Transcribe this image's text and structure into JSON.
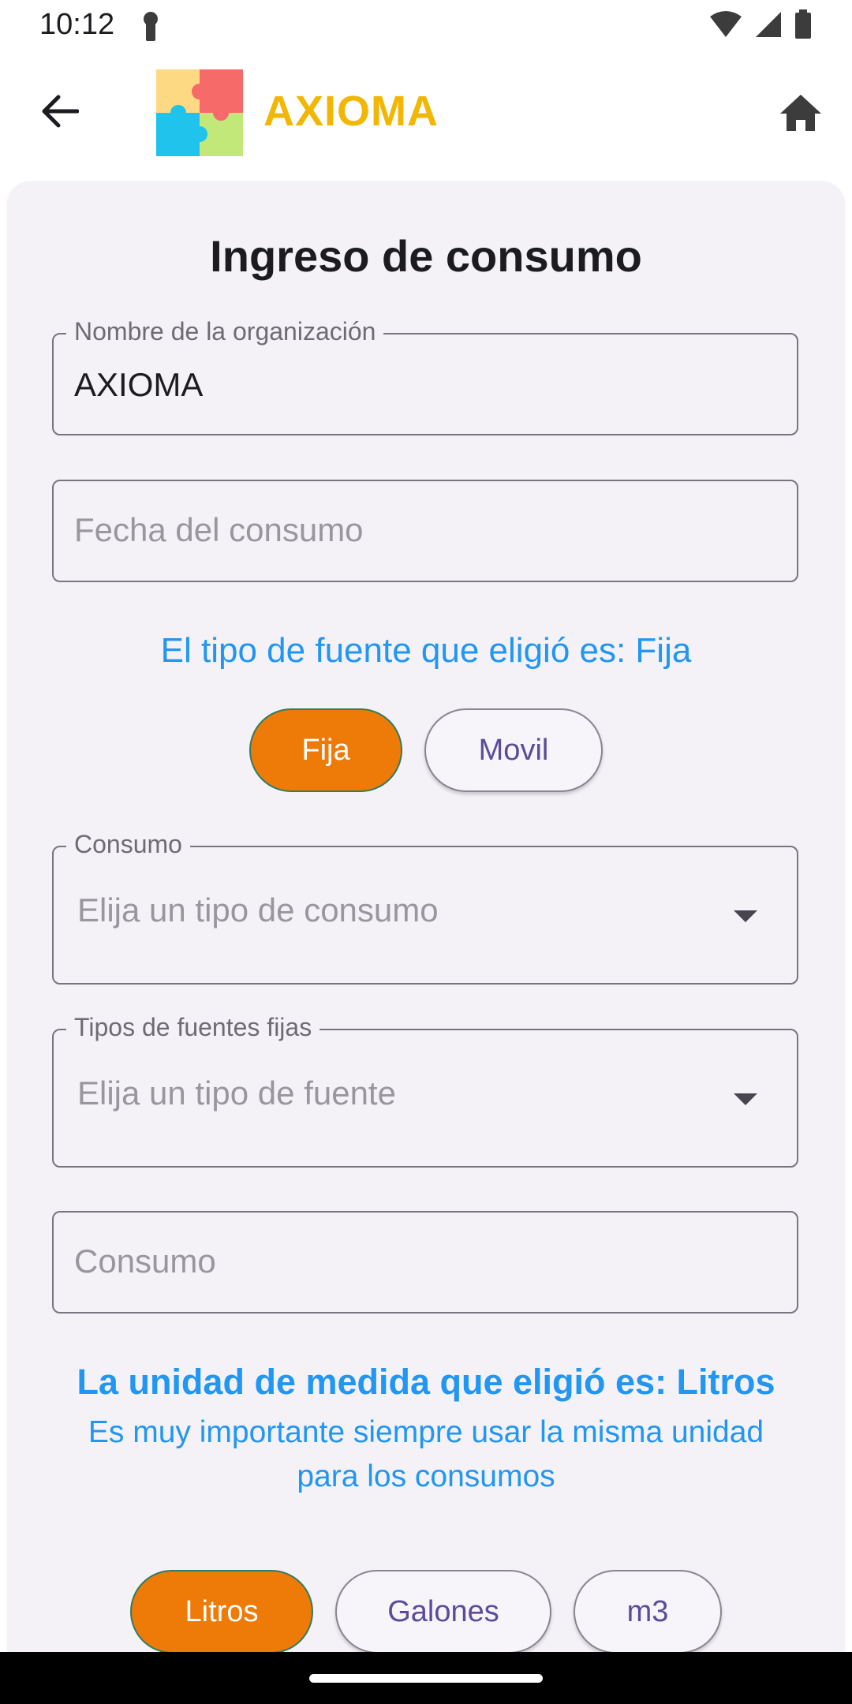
{
  "status_bar": {
    "time": "10:12",
    "left_icon": "key-notification-icon",
    "right_icons": [
      "wifi-icon",
      "signal-icon",
      "battery-icon"
    ]
  },
  "app_bar": {
    "back_icon": "arrow-back-icon",
    "logo_icon": "puzzle-logo-icon",
    "title": "AXIOMA",
    "home_icon": "home-icon"
  },
  "form": {
    "title": "Ingreso de consumo",
    "organization": {
      "label": "Nombre de la organización",
      "value": "AXIOMA"
    },
    "date": {
      "placeholder": "Fecha del consumo"
    },
    "source_type_info": "El tipo de fuente que eligió es: Fija",
    "source_types": [
      {
        "label": "Fija",
        "selected": true
      },
      {
        "label": "Movil",
        "selected": false
      }
    ],
    "consumption_type": {
      "label": "Consumo",
      "placeholder": "Elija un tipo de consumo"
    },
    "fixed_source_type": {
      "label": "Tipos de fuentes fijas",
      "placeholder": "Elija un tipo de fuente"
    },
    "consumption_amount": {
      "placeholder": "Consumo"
    },
    "unit_info": "La unidad de medida que eligió es: Litros",
    "unit_note": "Es muy importante siempre usar la misma unidad para los consumos",
    "units": [
      {
        "label": "Litros",
        "selected": true
      },
      {
        "label": "Galones",
        "selected": false
      },
      {
        "label": "m3",
        "selected": false
      }
    ]
  },
  "colors": {
    "brand_yellow": "#F2B705",
    "accent_orange": "#EE7A08",
    "info_blue": "#2196F3",
    "unselected_text": "#5b4b9a"
  }
}
